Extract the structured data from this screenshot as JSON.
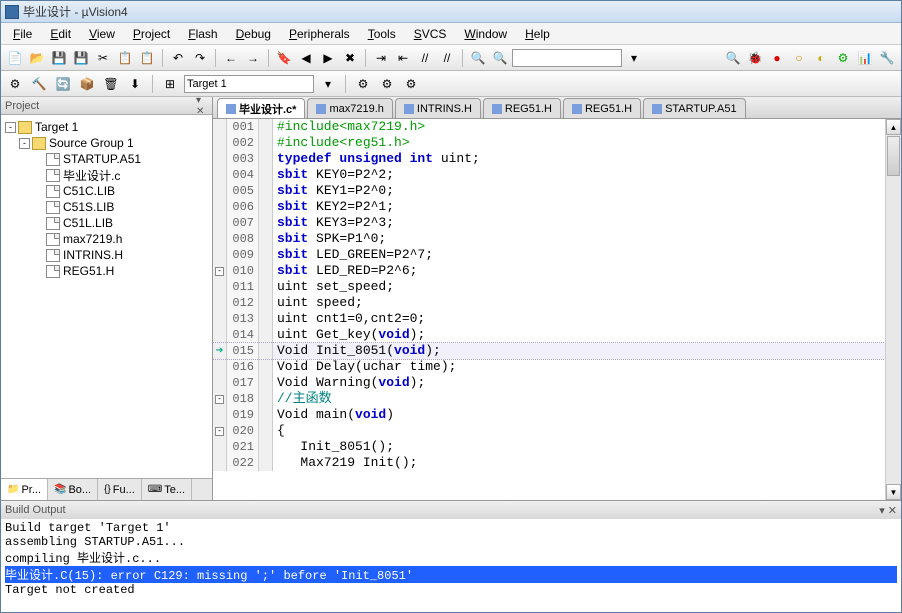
{
  "titlebar": {
    "title": "毕业设计 - µVision4"
  },
  "menus": [
    "File",
    "Edit",
    "View",
    "Project",
    "Flash",
    "Debug",
    "Peripherals",
    "Tools",
    "SVCS",
    "Window",
    "Help"
  ],
  "target_select": "Target 1",
  "project_panel": {
    "title": "Project",
    "root": "Target 1",
    "group": "Source Group 1",
    "files": [
      "STARTUP.A51",
      "毕业设计.c",
      "C51C.LIB",
      "C51S.LIB",
      "C51L.LIB",
      "max7219.h",
      "INTRINS.H",
      "REG51.H"
    ],
    "tabs": [
      "Pr...",
      "Bo...",
      "Fu...",
      "Te..."
    ]
  },
  "editor_tabs": [
    "毕业设计.c*",
    "max7219.h",
    "INTRINS.H",
    "REG51.H",
    "REG51.H",
    "STARTUP.A51"
  ],
  "code_lines": [
    {
      "n": "001",
      "html": "<span class='pp'>#include&lt;max7219.h&gt;</span>"
    },
    {
      "n": "002",
      "html": "<span class='pp'>#include&lt;reg51.h&gt;</span>"
    },
    {
      "n": "003",
      "html": "<span class='kw'>typedef unsigned int</span> uint;"
    },
    {
      "n": "004",
      "html": "<span class='kw'>sbit</span> KEY0=P2^2;"
    },
    {
      "n": "005",
      "html": "<span class='kw'>sbit</span> KEY1=P2^0;"
    },
    {
      "n": "006",
      "html": "<span class='kw'>sbit</span> KEY2=P2^1;"
    },
    {
      "n": "007",
      "html": "<span class='kw'>sbit</span> KEY3=P2^3;"
    },
    {
      "n": "008",
      "html": "<span class='kw'>sbit</span> SPK=P1^0;"
    },
    {
      "n": "009",
      "html": "<span class='kw'>sbit</span> LED_GREEN=P2^7;"
    },
    {
      "n": "010",
      "html": "<span class='kw'>sbit</span> LED_RED=P2^6;",
      "box": true
    },
    {
      "n": "011",
      "html": "uint set_speed;"
    },
    {
      "n": "012",
      "html": "uint speed;"
    },
    {
      "n": "013",
      "html": "uint cnt1=0,cnt2=0;"
    },
    {
      "n": "014",
      "html": "uint Get_key(<span class='kw'>void</span>);"
    },
    {
      "n": "015",
      "html": "Void Init_8051(<span class='kw'>void</span>);",
      "hl": true,
      "arrow": true
    },
    {
      "n": "016",
      "html": "Void Delay(uchar time);"
    },
    {
      "n": "017",
      "html": "Void Warning(<span class='kw'>void</span>);"
    },
    {
      "n": "018",
      "html": "<span class='cmt'>//主函数</span>",
      "box": true
    },
    {
      "n": "019",
      "html": "Void main(<span class='kw'>void</span>)"
    },
    {
      "n": "020",
      "html": "{",
      "box": true
    },
    {
      "n": "021",
      "html": "   Init_8051();"
    },
    {
      "n": "022",
      "html": "   Max7219 Init();"
    }
  ],
  "build_output": {
    "title": "Build Output",
    "lines": [
      {
        "t": "Build target 'Target 1'"
      },
      {
        "t": "assembling STARTUP.A51..."
      },
      {
        "t": "compiling 毕业设计.c..."
      },
      {
        "t": "毕业设计.C(15): error C129: missing ';' before 'Init_8051'",
        "err": true
      },
      {
        "t": "Target not created"
      }
    ]
  },
  "toolbar_icons_row1": [
    "new-file",
    "open",
    "save",
    "save-all",
    "cut",
    "copy",
    "paste",
    "",
    "undo",
    "redo",
    "",
    "nav-back",
    "nav-fwd",
    "",
    "bookmark",
    "bookmark-prev",
    "bookmark-next",
    "bookmark-clear",
    "",
    "indent",
    "outdent",
    "comment",
    "uncomment",
    "",
    "find-hw",
    "find"
  ],
  "toolbar_icons_row1_right": [
    "find",
    "debug",
    "breakpoint",
    "kill-bp",
    "disable-bp",
    "sw",
    "configure",
    "tools"
  ],
  "toolbar_icons_row2": [
    "build-file",
    "build",
    "rebuild",
    "batch",
    "clean",
    "download"
  ],
  "colors": {
    "highlight_bg": "#f2f0fa",
    "error_bg": "#2060ff"
  }
}
